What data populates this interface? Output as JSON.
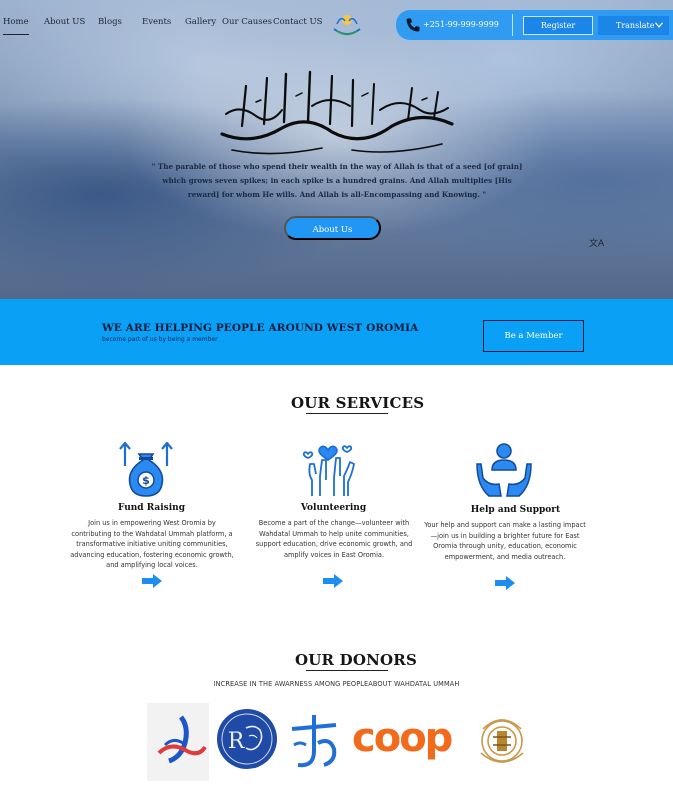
{
  "nav": {
    "items": [
      {
        "label": "Home",
        "active": true
      },
      {
        "label": "About US",
        "active": false
      },
      {
        "label": "Blogs",
        "active": false
      },
      {
        "label": "Events",
        "active": false
      },
      {
        "label": "Gallery",
        "active": false
      },
      {
        "label": "Our Causes",
        "active": false
      },
      {
        "label": "Contact US",
        "active": false
      }
    ],
    "logo_icon": "hands-logo-icon"
  },
  "contact": {
    "phone": "+251-99-999-9999",
    "register_label": "Register",
    "translate_label": "Translate"
  },
  "hero": {
    "verse": "\" The parable of those who spend their wealth in the way of Allah is that of a seed [of grain] which grows seven spikes; in each spike is a hundred grains. And Allah multiplies [His reward] for whom He wills. And Allah is all-Encompassing and Knowing. \"",
    "about_label": "About Us",
    "calligraphy_icon": "bismillah-calligraphy",
    "translate_icon": "translate-icon"
  },
  "band": {
    "title": "WE ARE HELPING PEOPLE AROUND WEST OROMIA",
    "subtitle": "become part of us by being a member",
    "button_label": "Be a Member"
  },
  "services": {
    "title": "OUR SERVICES",
    "items": [
      {
        "title": "Fund Raising",
        "text": "Join us in empowering West Oromia by contributing to the Wahdatal Ummah platform, a transformative initiative uniting communities, advancing education, fostering economic growth, and amplifying local voices.",
        "icon": "money-bag-icon"
      },
      {
        "title": "Volunteering",
        "text": "Become a part of the change—volunteer with Wahdatal Ummah to help unite communities, support education, drive economic growth, and amplify voices in East Oromia.",
        "icon": "raised-hands-heart-icon"
      },
      {
        "title": "Help and Support",
        "text": "Your help and support can make a lasting impact—join us in building a brighter future for East Oromia through unity, education, economic empowerment, and media outreach.",
        "icon": "hands-person-icon"
      }
    ]
  },
  "donors": {
    "title": "OUR DONORS",
    "subtitle": "INCREASE IN THE AWARNESS AMONG PEOPLEABOUT WAHDATAL UMMAH",
    "logos": [
      {
        "icon": "donor-logo-swoosh"
      },
      {
        "icon": "donor-logo-circle-seal"
      },
      {
        "icon": "donor-logo-blue-script"
      },
      {
        "text": "coop"
      },
      {
        "icon": "donor-logo-gold-emblem"
      }
    ]
  },
  "colors": {
    "accent": "#2196f3",
    "band": "#0aa0f5",
    "dark_navy": "#0d1b3d",
    "coop_orange": "#f26a1b"
  }
}
